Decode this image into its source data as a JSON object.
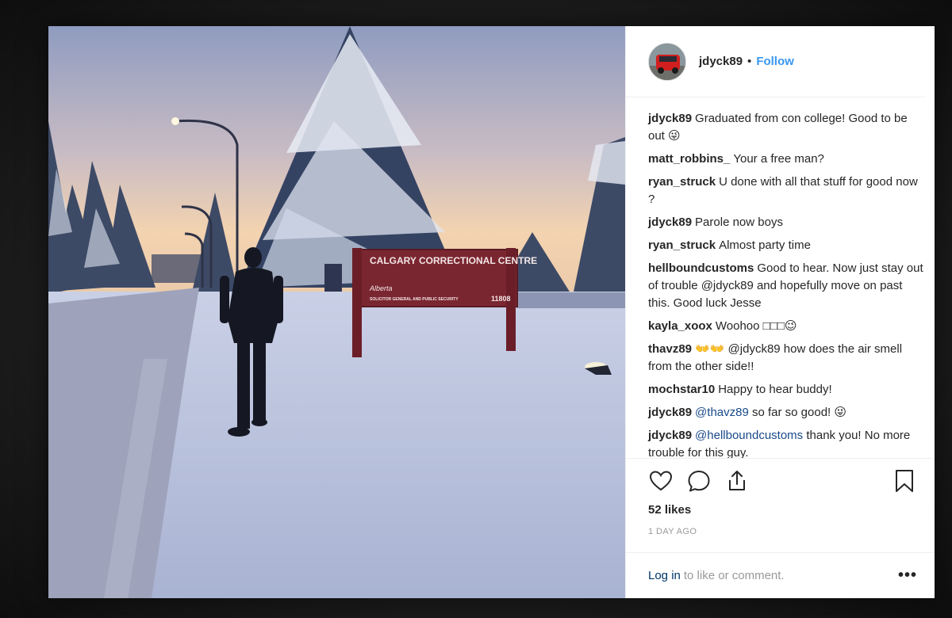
{
  "photo": {
    "sign_line1": "CALGARY CORRECTIONAL CENTRE",
    "sign_logo": "Alberta",
    "sign_line2": "SOLICITOR GENERAL AND PUBLIC SECURITY",
    "sign_number": "11808"
  },
  "header": {
    "username": "jdyck89",
    "separator": "•",
    "follow_label": "Follow"
  },
  "comments": [
    {
      "user": "jdyck89",
      "mention": "",
      "text": "Graduated from con college! Good to be out 😜"
    },
    {
      "user": "matt_robbins_",
      "mention": "",
      "text": "Your a free man?"
    },
    {
      "user": "ryan_struck",
      "mention": "",
      "text": "U done with all that stuff for good now ?"
    },
    {
      "user": "jdyck89",
      "mention": "",
      "text": "Parole now boys"
    },
    {
      "user": "ryan_struck",
      "mention": "",
      "text": "Almost party time"
    },
    {
      "user": "hellboundcustoms",
      "mention": "",
      "text": "Good to hear. Now just stay out of trouble @jdyck89 and hopefully move on past this. Good luck Jesse"
    },
    {
      "user": "kayla_xoox",
      "mention": "",
      "text": "Woohoo □□□😉"
    },
    {
      "user": "thavz89",
      "mention": "",
      "text": "👐👐 @jdyck89 how does the air smell from the other side!!"
    },
    {
      "user": "mochstar10",
      "mention": "",
      "text": "Happy to hear buddy!"
    },
    {
      "user": "jdyck89",
      "mention": "@thavz89",
      "text": "so far so good! 😜"
    },
    {
      "user": "jdyck89",
      "mention": "@hellboundcustoms",
      "text": "thank you! No more trouble for this guy."
    }
  ],
  "actions": {
    "like_icon": "heart-icon",
    "comment_icon": "comment-bubble-icon",
    "share_icon": "share-icon",
    "save_icon": "bookmark-icon"
  },
  "likes": "52 likes",
  "timestamp": "1 DAY AGO",
  "footer": {
    "login_label": "Log in",
    "login_suffix": "to like or comment.",
    "more_label": "•••"
  },
  "colors": {
    "link": "#3897f0",
    "mention": "#1a4a8a",
    "text": "#262626",
    "muted": "#999999"
  }
}
